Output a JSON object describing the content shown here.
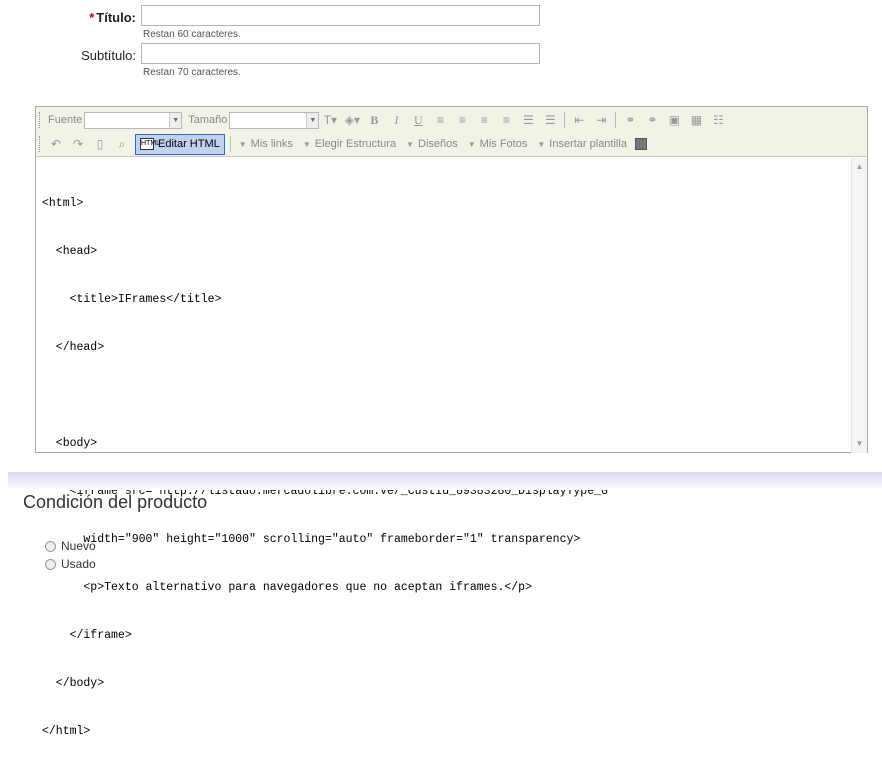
{
  "form": {
    "title_required_mark": "*",
    "title_label": "Título:",
    "title_value": "",
    "title_hint": "Restan 60 caracteres.",
    "subtitle_label": "Subtítulo:",
    "subtitle_value": "",
    "subtitle_hint": "Restan 70 caracteres."
  },
  "toolbar": {
    "font_label": "Fuente",
    "size_label": "Tamaño",
    "bold": "B",
    "italic": "I",
    "underline": "U",
    "edit_html": "Editar HTML",
    "edit_html_icon": "HTML",
    "menus": [
      "Mis links",
      "Elegir Estructura",
      "Diseños",
      "Mis Fotos",
      "Insertar plantilla"
    ]
  },
  "editor": {
    "code_lines": [
      "<html>",
      "  <head>",
      "    <title>IFrames</title>",
      "  </head>",
      "",
      "  <body>",
      "    <iframe src=\"http://listado.mercadolibre.com.ve/_CustId_89383280_DisplayType_G\"",
      "      width=\"900\" height=\"1000\" scrolling=\"auto\" frameborder=\"1\" transparency>",
      "      <p>Texto alternativo para navegadores que no aceptan iframes.</p>",
      "    </iframe>",
      "  </body>",
      "</html>"
    ]
  },
  "section": {
    "title": "Condición del producto",
    "options": [
      "Nuevo",
      "Usado"
    ]
  }
}
